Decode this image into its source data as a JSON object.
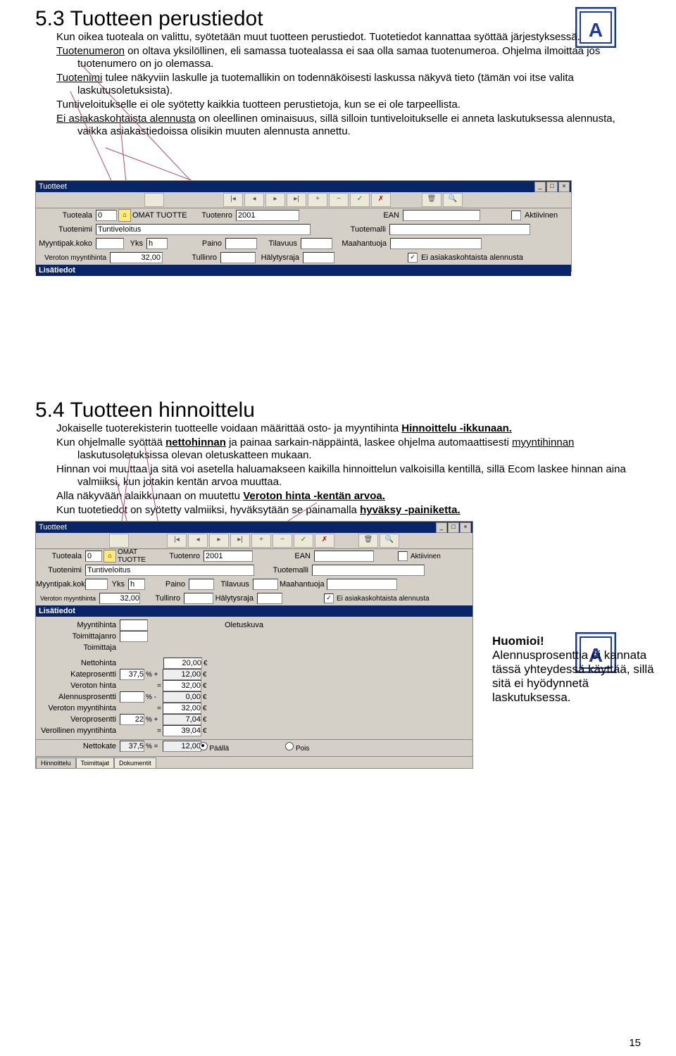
{
  "section53": {
    "title": "5.3 Tuotteen perustiedot",
    "p1": "Kun oikea tuoteala on valittu, syötetään muut tuotteen perustiedot. Tuotetiedot kannattaa syöttää järjestyksessä.",
    "p2a": "Tuotenumeron",
    "p2b": " on oltava yksilöllinen, eli samassa tuotealassa ei saa olla samaa tuotenumeroa.  Ohjelma ilmoittaa jos tuotenumero on jo olemassa.",
    "p3a": "Tuotenimi",
    "p3b": " tulee näkyviin laskulle ja tuotemallikin on todennäköisesti laskussa näkyvä tieto (tämän voi itse valita laskutusoletuksista).",
    "p4": "Tuntiveloitukselle ei ole syötetty kaikkia tuotteen perustietoja, kun se ei ole tarpeellista.",
    "p5a": "Ei asiakaskohtaista alennusta",
    "p5b": " on oleellinen ominaisuus, sillä silloin tuntiveloitukselle ei anneta laskutuksessa alennusta, vaikka asiakastiedoissa olisikin muuten alennusta annettu."
  },
  "section54": {
    "title": "5.4 Tuotteen hinnoittelu",
    "p1a": "Jokaiselle tuoterekisterin tuotteelle voidaan määrittää osto- ja myyntihinta ",
    "p1b": "Hinnoittelu -ikkunaan.",
    "p2a": "Kun ohjelmalle syöttää ",
    "p2b": "nettohinnan",
    "p2c": "  ja painaa sarkain-näppäintä, laskee ohjelma automaattisesti ",
    "p2d": "myyntihinnan",
    "p2e": " laskutusoletuksissa olevan oletuskatteen mukaan.",
    "p3": "Hinnan voi muuttaa ja sitä voi asetella haluamakseen kaikilla hinnoittelun valkoisilla kentillä, sillä Ecom laskee hinnan aina valmiiksi, kun jotakin kentän arvoa muuttaa.",
    "p4a": "Alla näkyvään alaikkunaan on muutettu ",
    "p4b": "Veroton hinta -kentän arvoa.",
    "p5a": "Kun tuotetiedot on syötetty valmiiksi, hyväksytään se painamalla ",
    "p5b": "hyväksy -painiketta."
  },
  "huomioi": {
    "title": "Huomioi!",
    "body": "Alennusprosenttia ei kannata tässä yhteydessä käyttää, sillä sitä ei hyödynnetä laskutuksessa."
  },
  "win": {
    "title": "Tuotteet",
    "tuoteala_l": "Tuoteala",
    "tuoteala_v": "0",
    "tuoteala_name": "OMAT TUOTTE",
    "tuotenro_l": "Tuotenro",
    "tuotenro_v": "2001",
    "ean_l": "EAN",
    "aktiivinen": "Aktiivinen",
    "tuotenimi_l": "Tuotenimi",
    "tuotenimi_v": "Tuntiveloitus",
    "tuotemalli_l": "Tuotemalli",
    "mpk_l": "Myyntipak.koko",
    "yks_l": "Yks",
    "yks_v": "h",
    "paino_l": "Paino",
    "tilavuus_l": "Tilavuus",
    "maahantuoja_l": "Maahantuoja",
    "vmh_l": "Veroton myyntihinta",
    "vmh_v": "32,00",
    "tullinro_l": "Tullinro",
    "halytys_l": "Hälytysraja",
    "eak": "Ei asiakaskohtaista alennusta",
    "lisatiedot": "Lisätiedot"
  },
  "win2": {
    "myyntihinta": "Myyntihinta",
    "toimittajanro": "Toimittajanro",
    "toimittaja": "Toimittaja",
    "nettohinta": "Nettohinta",
    "nettohinta_v": "20,00",
    "eur": "€",
    "kateprosentti": "Kateprosentti",
    "kateprosentti_v": "37,5",
    "kp_plus": "% +",
    "kp_res": "12,00",
    "veroton_hinta": "Veroton hinta",
    "vh_eq": "=",
    "vh_res": "32,00",
    "alennusprosentti": "Alennusprosentti",
    "ap_minus": "% -",
    "ap_res": "0,00",
    "veroton_myyntihinta": "Veroton myyntihinta",
    "vmh_eq": "=",
    "vmh_res": "32,00",
    "veroprosentti": "Veroprosentti",
    "vp_v": "22",
    "vp_plus": "% +",
    "vp_res": "7,04",
    "verollinen_myyntihinta": "Verollinen myyntihinta",
    "vrmh_eq": "=",
    "vrmh_res": "39,04",
    "nettokate": "Nettokate",
    "nk_v": "37,5",
    "nk_eq": "% =",
    "nk_res": "12,00",
    "oletuskuva": "Oletuskuva",
    "paalla": "Päällä",
    "pois": "Pois",
    "tab_h": "Hinnoittelu",
    "tab_t": "Toimittajat",
    "tab_d": "Dokumentit"
  },
  "pagenum": "15"
}
